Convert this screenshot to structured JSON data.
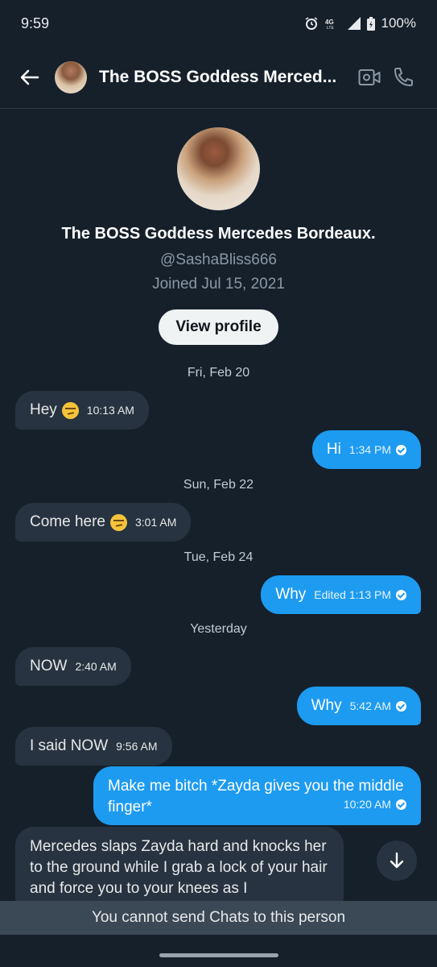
{
  "status": {
    "time": "9:59",
    "network": "4G LTE",
    "battery": "100%"
  },
  "header": {
    "title": "The BOSS Goddess Merced..."
  },
  "profile": {
    "name": "The BOSS Goddess Mercedes Bordeaux.",
    "handle": "@SashaBliss666",
    "joined": "Joined Jul 15, 2021",
    "view_profile_label": "View profile"
  },
  "dates": [
    "Fri, Feb 20",
    "Sun, Feb 22",
    "Tue, Feb 24",
    "Yesterday"
  ],
  "messages": [
    {
      "dir": "in",
      "text": "Hey",
      "emoji": "smirk",
      "time": "10:13 AM"
    },
    {
      "dir": "out",
      "text": "Hi",
      "time": "1:34 PM"
    },
    {
      "dir": "in",
      "text": "Come here",
      "emoji": "smirk",
      "time": "3:01 AM"
    },
    {
      "dir": "out",
      "text": "Why",
      "time": "Edited 1:13 PM"
    },
    {
      "dir": "in",
      "text": "NOW",
      "time": "2:40 AM"
    },
    {
      "dir": "out",
      "text": "Why",
      "time": "5:42 AM"
    },
    {
      "dir": "in",
      "text": "I said NOW",
      "time": "9:56 AM"
    },
    {
      "dir": "out",
      "text": "Make me bitch *Zayda gives you the middle finger*",
      "time": "10:20 AM"
    },
    {
      "dir": "in",
      "text": "Mercedes slaps Zayda hard and knocks her to the ground while I grab a lock of your hair and force you to your knees as I"
    }
  ],
  "footer": {
    "notice": "You cannot send Chats to this person"
  },
  "colors": {
    "background": "#15202b",
    "outgoing": "#1d9bf0",
    "incoming": "#273340"
  }
}
